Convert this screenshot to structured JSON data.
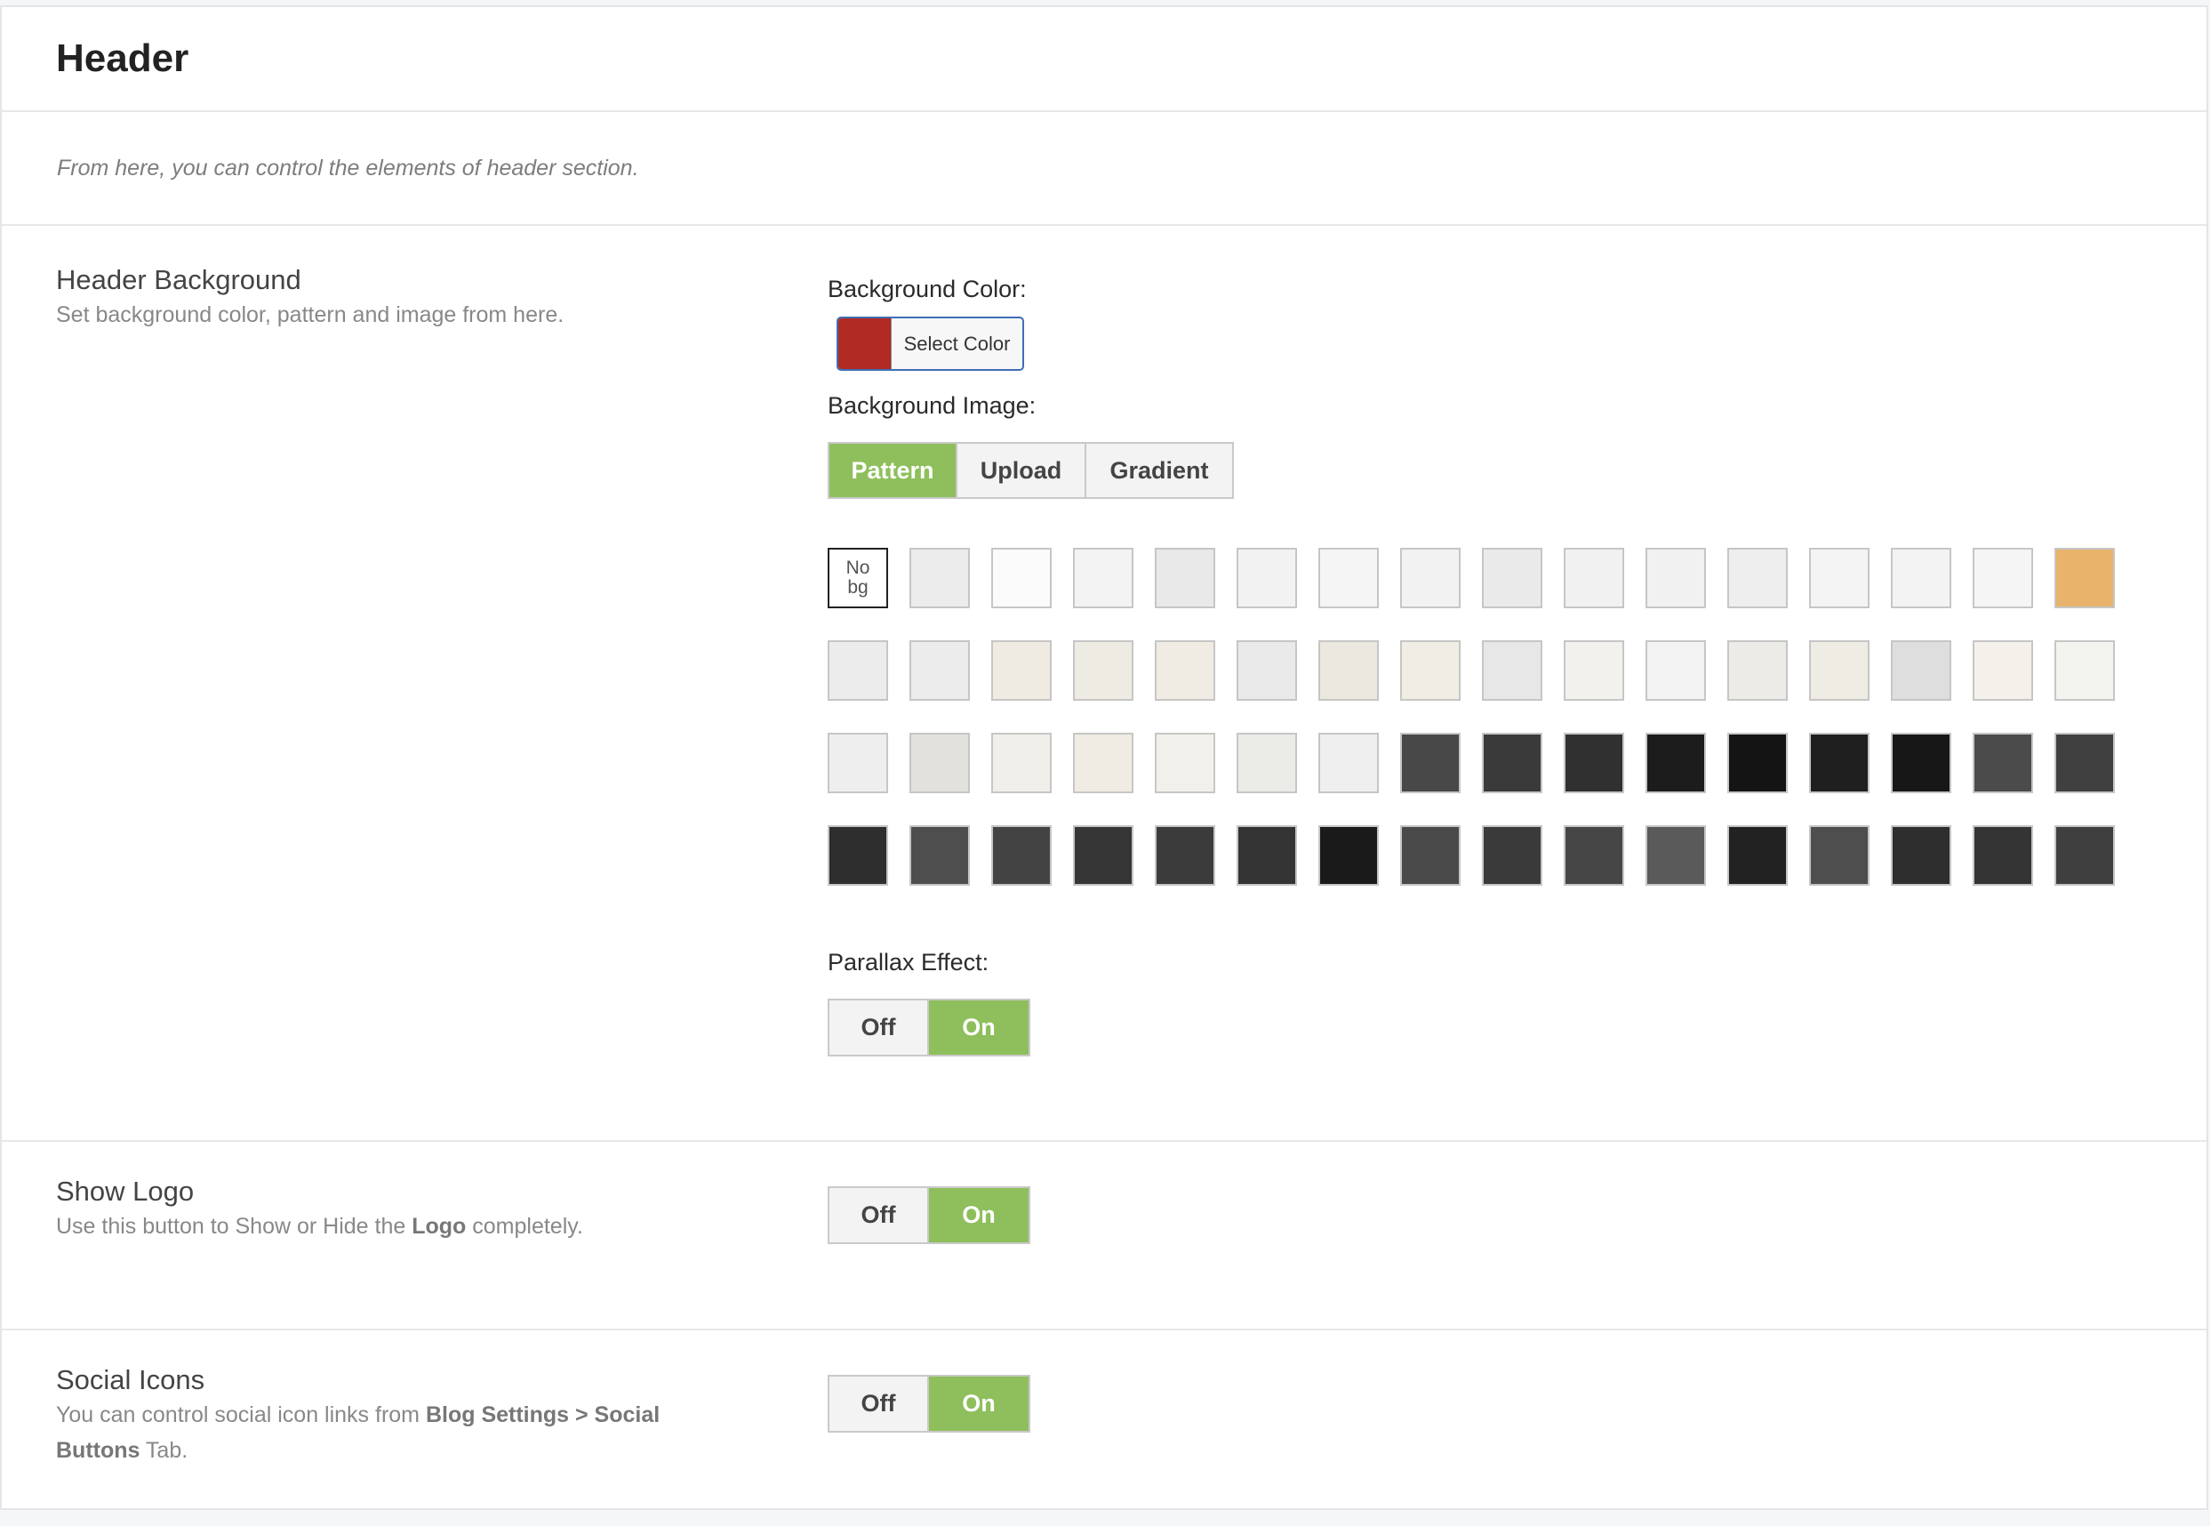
{
  "header": {
    "title": "Header"
  },
  "description": "From here, you can control the elements of header section.",
  "header_background": {
    "title": "Header Background",
    "subtitle": "Set background color, pattern and image from here.",
    "background_color_label": "Background Color:",
    "color_swatch": "#b22a24",
    "select_color_label": "Select Color",
    "background_image_label": "Background Image:",
    "tabs": [
      {
        "label": "Pattern",
        "active": true
      },
      {
        "label": "Upload",
        "active": false
      },
      {
        "label": "Gradient",
        "active": false
      }
    ],
    "no_bg_label": "No bg",
    "pattern_colors": [
      [
        "#ffffff",
        "#ececec",
        "#fbfbfb",
        "#f3f3f3",
        "#e9e9e9",
        "#f2f2f2",
        "#f5f5f5",
        "#f2f2f2",
        "#eaeaea",
        "#f1f1f1",
        "#f1f1f1",
        "#eeeeee",
        "#f4f4f4",
        "#f3f3f3",
        "#f5f5f5",
        "#e8b36a"
      ],
      [
        "#ececec",
        "#ececec",
        "#efebe3",
        "#eeebe2",
        "#f0ece4",
        "#eaeaea",
        "#ebe8df",
        "#f0ede4",
        "#e7e7e7",
        "#f2f1ee",
        "#f3f3f3",
        "#ecebe7",
        "#efece4",
        "#dedede",
        "#f3f1ea",
        "#f3f3ef"
      ],
      [
        "#eeeeee",
        "#e2e1dd",
        "#f1efe9",
        "#f0ece3",
        "#f2f0ea",
        "#ebebe8",
        "#efefef",
        "#484848",
        "#3a3a3a",
        "#303030",
        "#1c1c1c",
        "#141414",
        "#1f1f1f",
        "#171717",
        "#4b4b4b",
        "#404040"
      ],
      [
        "#2e2e2e",
        "#4e4e4e",
        "#434343",
        "#363636",
        "#3b3b3b",
        "#333333",
        "#1a1a1a",
        "#4a4a4a",
        "#3a3a3a",
        "#464646",
        "#5a5a5a",
        "#222222",
        "#4e4e4e",
        "#2e2e2e",
        "#343434",
        "#3f3f3f"
      ]
    ],
    "parallax_label": "Parallax Effect:",
    "parallax": {
      "off_label": "Off",
      "on_label": "On",
      "value": "On"
    }
  },
  "show_logo": {
    "title": "Show Logo",
    "subtitle_pre": "Use this button to Show or Hide the ",
    "subtitle_bold": "Logo",
    "subtitle_post": " completely.",
    "off_label": "Off",
    "on_label": "On",
    "value": "On"
  },
  "social_icons": {
    "title": "Social Icons",
    "subtitle_pre": "You can control social icon links from ",
    "subtitle_bold": "Blog Settings > Social Buttons",
    "subtitle_post": " Tab.",
    "off_label": "Off",
    "on_label": "On",
    "value": "On"
  }
}
